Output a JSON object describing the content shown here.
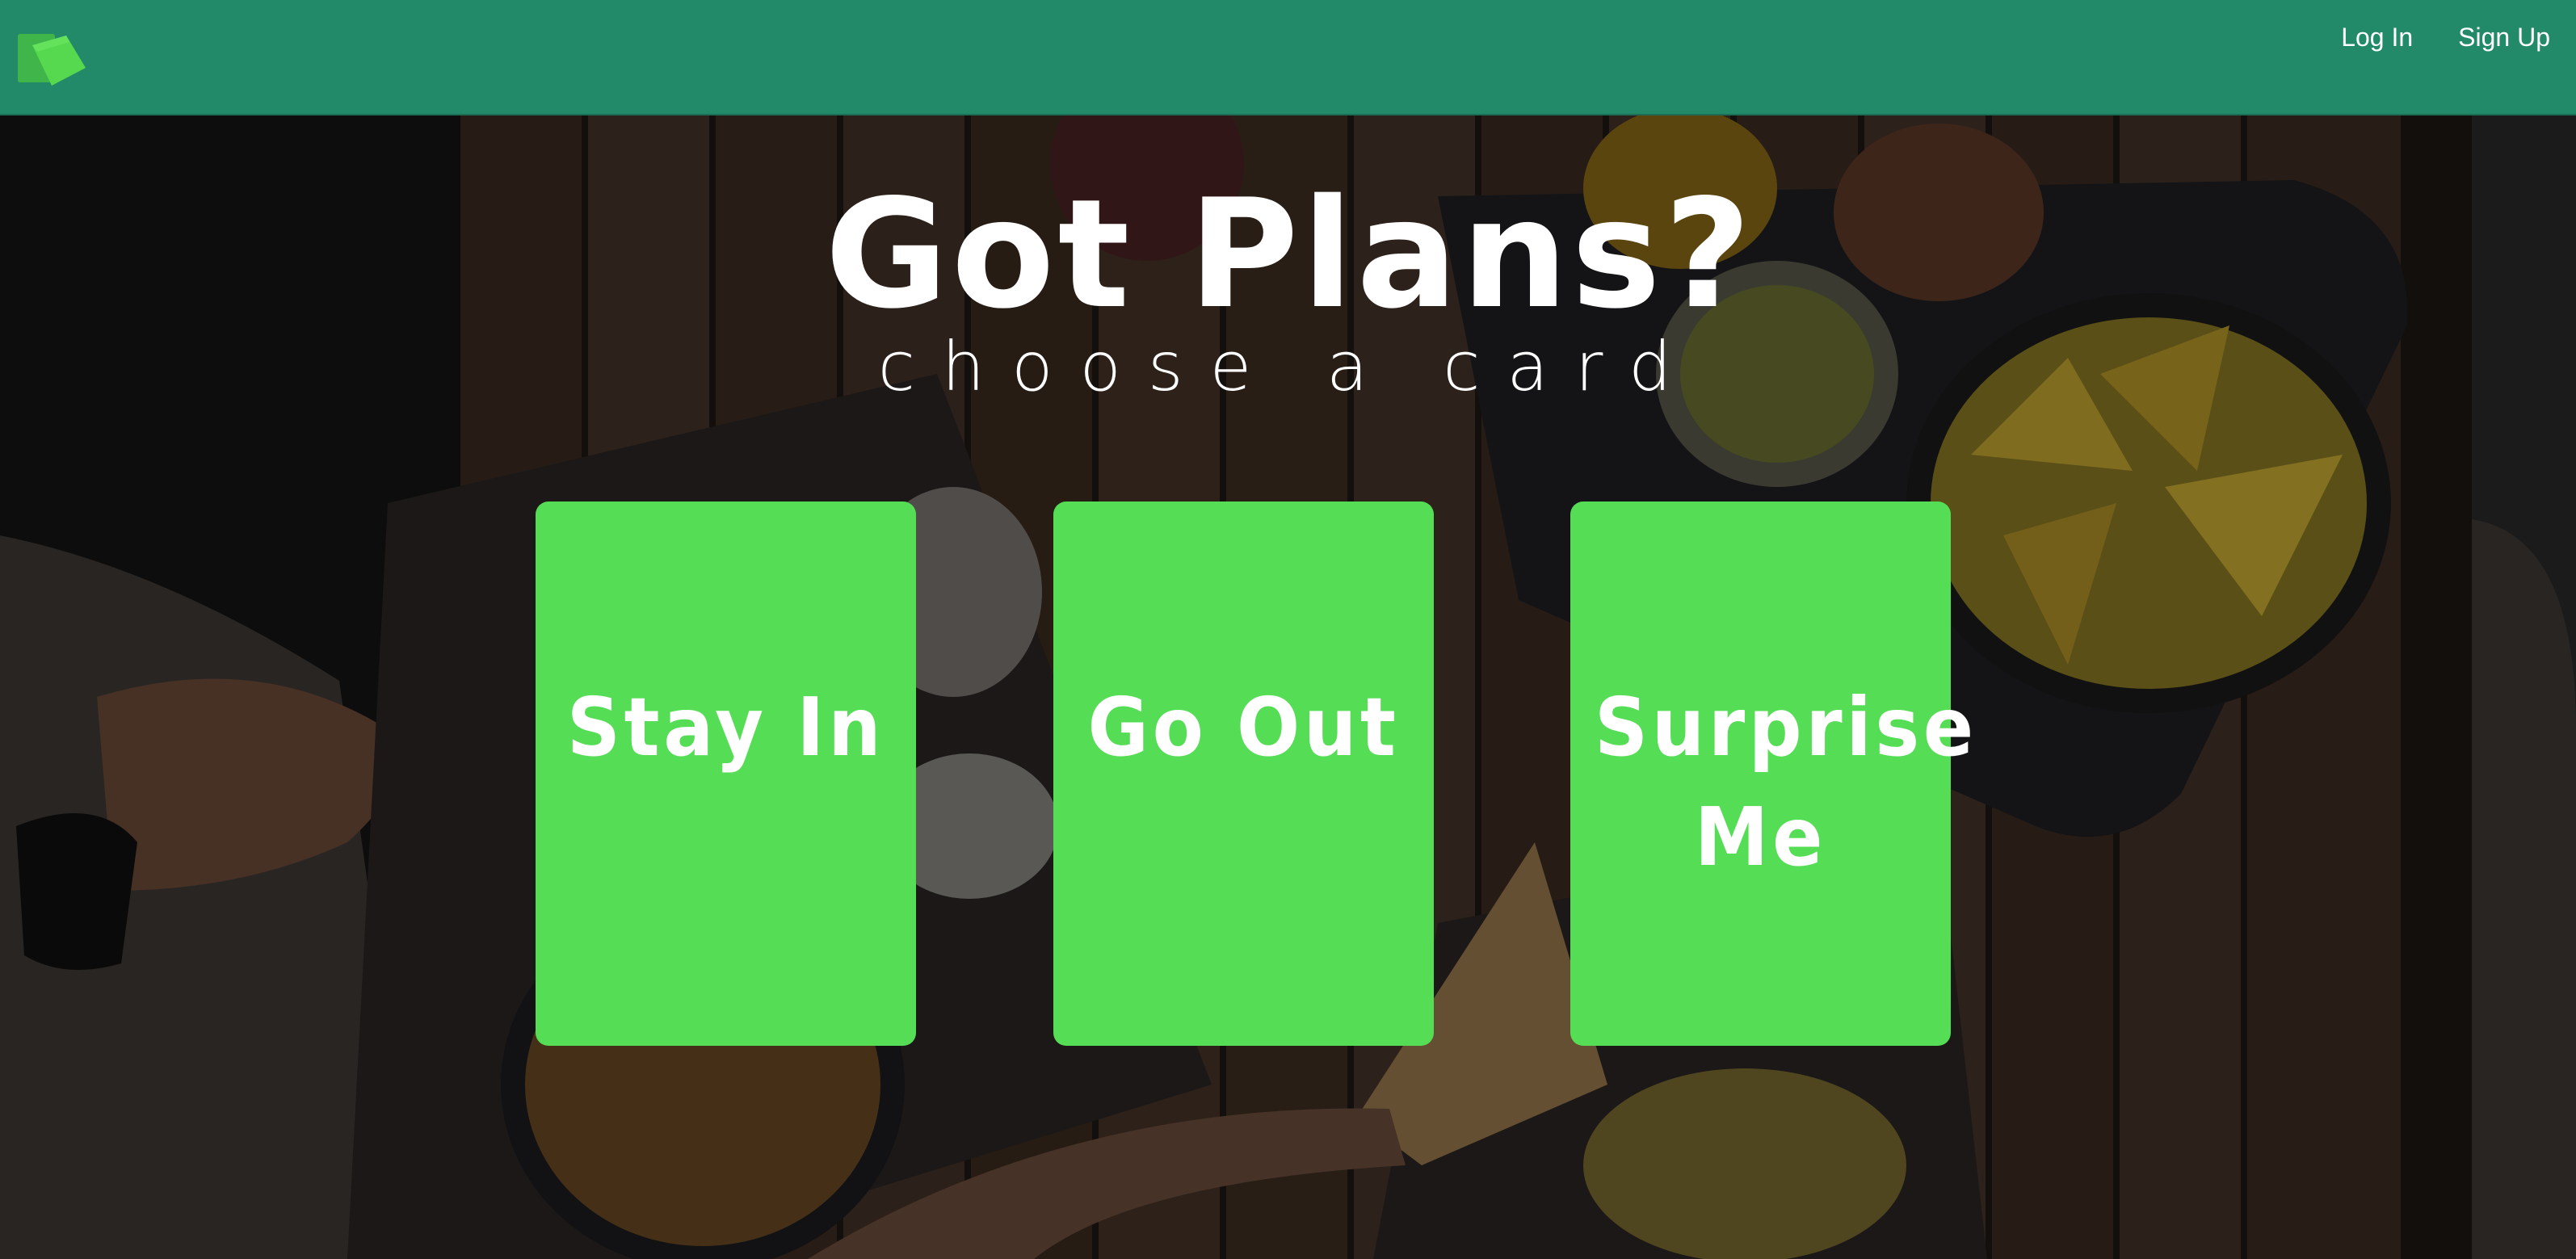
{
  "nav": {
    "logo": "cards-logo-icon",
    "login_label": "Log In",
    "signup_label": "Sign Up"
  },
  "hero": {
    "title": "Got Plans?",
    "subtitle": "choose a card"
  },
  "cards": [
    {
      "label": "Stay In"
    },
    {
      "label": "Go Out"
    },
    {
      "label": "Surprise Me"
    }
  ],
  "colors": {
    "navbar": "#238a69",
    "card": "#55dd55",
    "text": "#ffffff"
  }
}
